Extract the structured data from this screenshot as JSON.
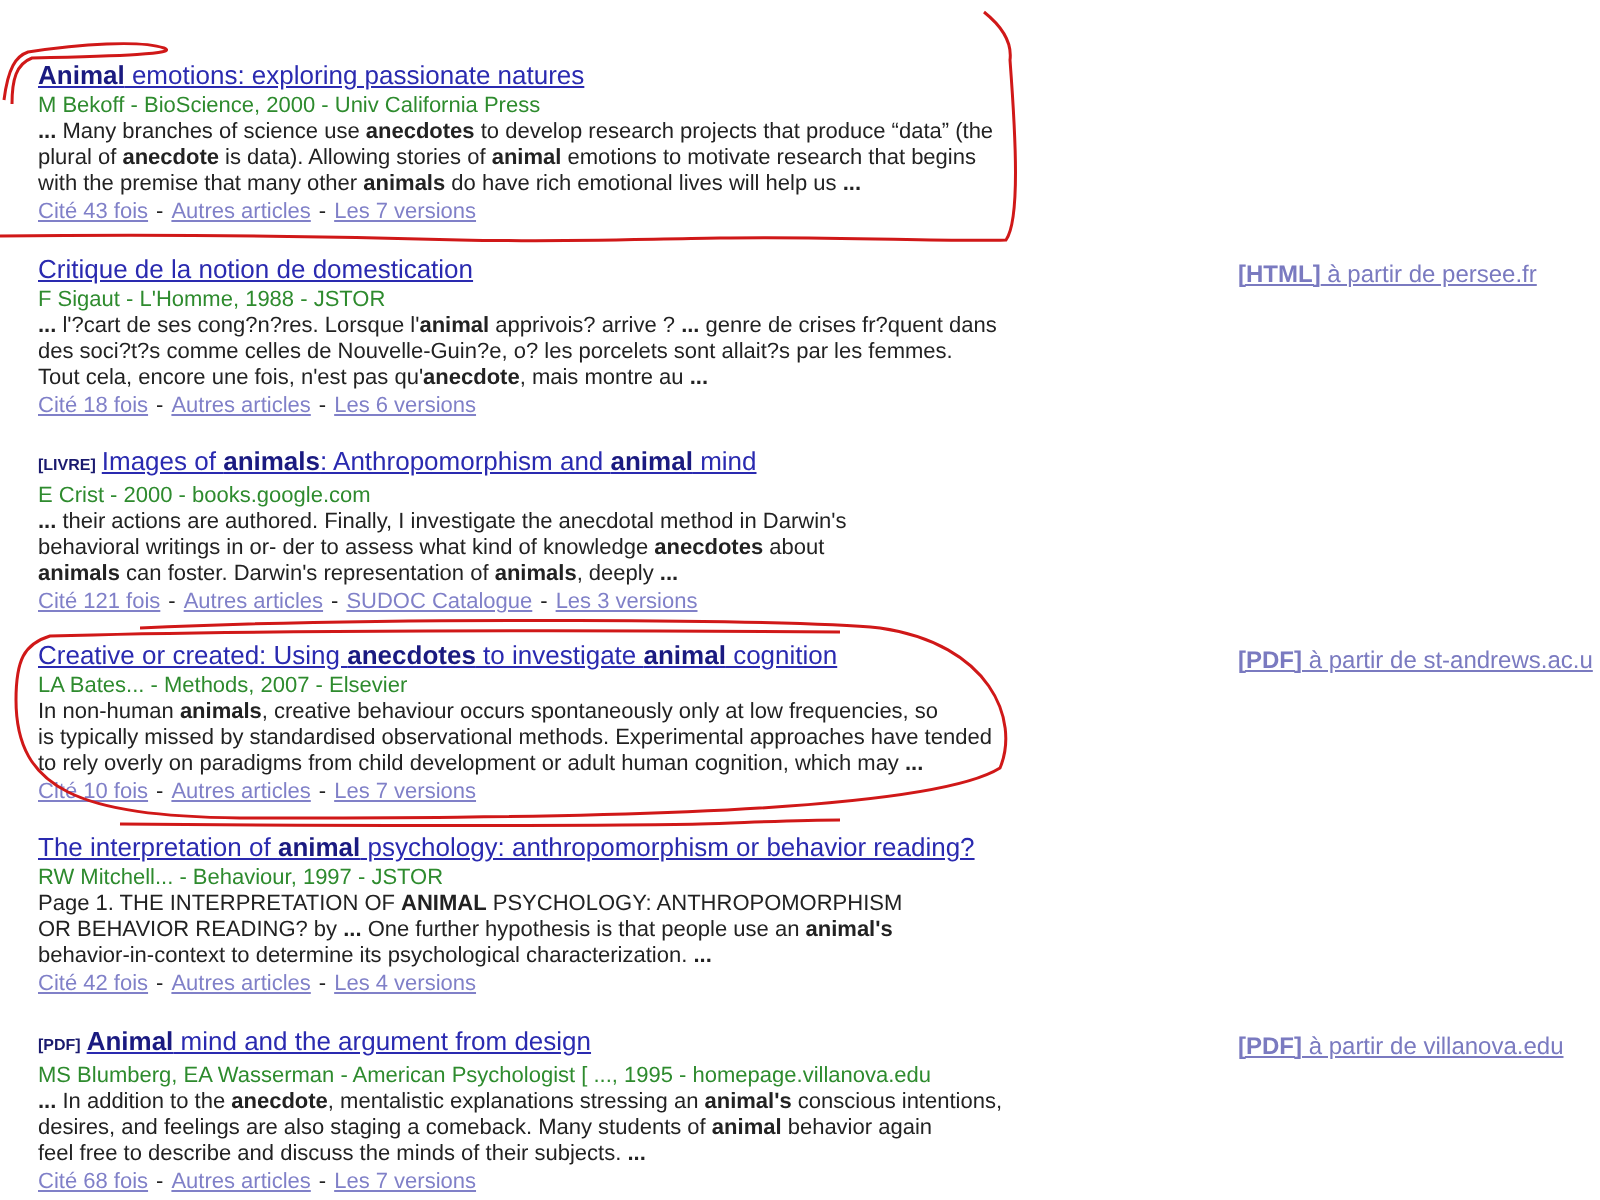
{
  "results": [
    {
      "title": "**Animal** emotions: exploring passionate natures",
      "meta": "M Bekoff - BioScience, 2000 - Univ California Press",
      "snippet": [
        "**...** Many branches of science use **anecdotes** to develop research projects that produce “data” (the",
        "plural of **anecdote** is data). Allowing stories of **animal** emotions to motivate research that begins",
        "with the premise that many other **animals** do have rich emotional lives will help us **...**"
      ],
      "links": [
        {
          "kind": "link",
          "text": "Cité 43 fois"
        },
        {
          "kind": "separator",
          "text": "-"
        },
        {
          "kind": "link",
          "text": "Autres articles"
        },
        {
          "kind": "separator",
          "text": "-"
        },
        {
          "kind": "link",
          "text": "Les 7 versions"
        }
      ]
    },
    {
      "title": "Critique de la notion de domestication",
      "meta": "F Sigaut - L'Homme, 1988 - JSTOR",
      "snippet": [
        "**...** l'?cart de ses cong?n?res. Lorsque l'**animal** apprivois? arrive ? **...** genre de crises fr?quent dans",
        "des soci?t?s comme celles de Nouvelle-Guin?e, o? les porcelets sont allait?s par les femmes.",
        "Tout cela, encore une fois, n'est pas qu'**anecdote**, mais montre au **...**"
      ],
      "links": [
        {
          "kind": "link",
          "text": "Cité 18 fois"
        },
        {
          "kind": "separator",
          "text": "-"
        },
        {
          "kind": "link",
          "text": "Autres articles"
        },
        {
          "kind": "separator",
          "text": "-"
        },
        {
          "kind": "link",
          "text": "Les 6 versions"
        }
      ],
      "side_link": "**[HTML]** à partir de persee.fr"
    },
    {
      "tag": "[LIVRE]",
      "title": "Images of **animals**: Anthropomorphism and **animal** mind",
      "meta": "E Crist - 2000 - books.google.com",
      "snippet": [
        "**...** their actions are authored. Finally, I investigate the anecdotal method in Darwin's",
        "behavioral writings in or- der to assess what kind of knowledge **anecdotes** about",
        "**animals** can foster. Darwin's representation of **animals**, deeply **...**"
      ],
      "links": [
        {
          "kind": "link",
          "text": "Cité 121 fois"
        },
        {
          "kind": "separator",
          "text": "-"
        },
        {
          "kind": "link",
          "text": "Autres articles"
        },
        {
          "kind": "separator",
          "text": "-"
        },
        {
          "kind": "link",
          "text": "SUDOC Catalogue"
        },
        {
          "kind": "separator",
          "text": "-"
        },
        {
          "kind": "link",
          "text": "Les 3 versions"
        }
      ]
    },
    {
      "title": "Creative or created: Using **anecdotes** to investigate **animal** cognition",
      "meta": "LA Bates... - Methods, 2007 - Elsevier",
      "snippet": [
        "In non-human **animals**, creative behaviour occurs spontaneously only at low frequencies, so",
        "is typically missed by standardised observational methods. Experimental approaches have tended",
        "to rely overly on paradigms from child development or adult human cognition, which may **...**"
      ],
      "links": [
        {
          "kind": "link",
          "text": "Cité 10 fois"
        },
        {
          "kind": "separator",
          "text": "-"
        },
        {
          "kind": "link",
          "text": "Autres articles"
        },
        {
          "kind": "separator",
          "text": "-"
        },
        {
          "kind": "link",
          "text": "Les 7 versions"
        }
      ],
      "side_link": "**[PDF]** à partir de st-andrews.ac.u"
    },
    {
      "title": "The interpretation of **animal** psychology: anthropomorphism or behavior reading?",
      "meta": "RW Mitchell... - Behaviour, 1997 - JSTOR",
      "snippet": [
        "Page 1. THE INTERPRETATION OF **ANIMAL** PSYCHOLOGY: ANTHROPOMORPHISM",
        "OR BEHAVIOR READING? by **...** One further hypothesis is that people use an **animal's**",
        "behavior-in-context to determine its psychological characterization. **...**"
      ],
      "links": [
        {
          "kind": "link",
          "text": "Cité 42 fois"
        },
        {
          "kind": "separator",
          "text": "-"
        },
        {
          "kind": "link",
          "text": "Autres articles"
        },
        {
          "kind": "separator",
          "text": "-"
        },
        {
          "kind": "link",
          "text": "Les 4 versions"
        }
      ]
    },
    {
      "tag": "[PDF]",
      "title": "**Animal** mind and the argument from design",
      "meta": "MS Blumberg, EA Wasserman - American Psychologist [ ..., 1995 - homepage.villanova.edu",
      "snippet": [
        "**...** In addition to the **anecdote**, mentalistic explanations stressing an **animal's** conscious intentions,",
        "desires, and feelings are also staging a comeback. Many students of **animal** behavior again",
        "feel free to describe and discuss the minds of their subjects. **...**"
      ],
      "links": [
        {
          "kind": "link",
          "text": "Cité 68 fois"
        },
        {
          "kind": "separator",
          "text": "-"
        },
        {
          "kind": "link",
          "text": "Autres articles"
        },
        {
          "kind": "separator",
          "text": "-"
        },
        {
          "kind": "link",
          "text": "Les 7 versions"
        }
      ],
      "side_link": "**[PDF]** à partir de villanova.edu"
    }
  ]
}
